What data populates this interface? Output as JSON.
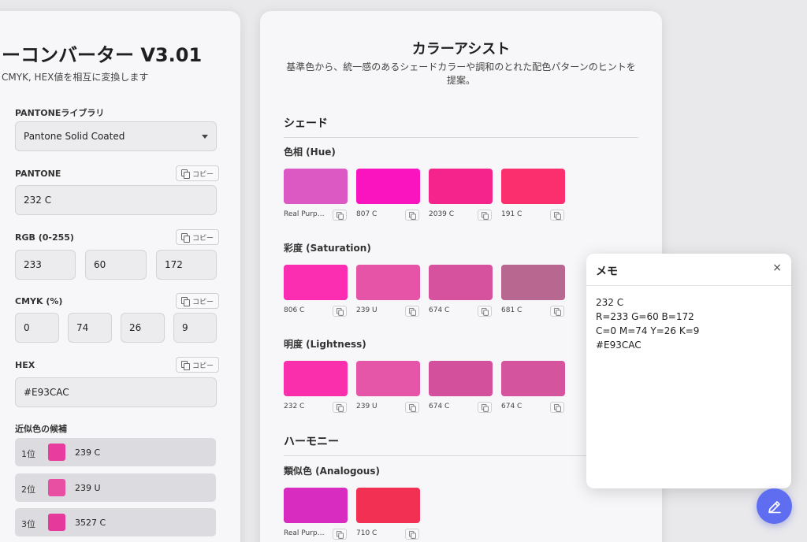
{
  "converter": {
    "title": "ーコンバーター V3.01",
    "subtitle": "CMYK, HEX値を相互に変換します",
    "library_label": "PANTONEライブラリ",
    "library_value": "Pantone Solid Coated",
    "copy_label": "コピー",
    "pantone_label": "PANTONE",
    "pantone_value": "232 C",
    "rgb_label": "RGB (0-255)",
    "rgb": [
      "233",
      "60",
      "172"
    ],
    "cmyk_label": "CMYK (%)",
    "cmyk": [
      "0",
      "74",
      "26",
      "9"
    ],
    "hex_label": "HEX",
    "hex_value": "#E93CAC",
    "candidates_label": "近似色の候補",
    "candidates": [
      {
        "rank": "1位",
        "name": "239 C",
        "color": "#e93c9f"
      },
      {
        "rank": "2位",
        "name": "239 U",
        "color": "#e84ea2"
      },
      {
        "rank": "3位",
        "name": "3527 C",
        "color": "#e5399b"
      }
    ]
  },
  "assist": {
    "title": "カラーアシスト",
    "description": "基準色から、統一感のあるシェードカラーや調和のとれた配色パターンのヒントを提案。",
    "shade_title": "シェード",
    "harmony_title": "ハーモニー",
    "groups": [
      {
        "label": "色相 (Hue)",
        "swatches": [
          {
            "name": "Real Purp…",
            "color": "#dc58c3"
          },
          {
            "name": "807 C",
            "color": "#f914c0"
          },
          {
            "name": "2039 C",
            "color": "#f4248c"
          },
          {
            "name": "191 C",
            "color": "#fb2e6e"
          }
        ]
      },
      {
        "label": "彩度 (Saturation)",
        "swatches": [
          {
            "name": "806 C",
            "color": "#fb2eb1"
          },
          {
            "name": "239 U",
            "color": "#e554a7"
          },
          {
            "name": "674 C",
            "color": "#d6529e"
          },
          {
            "name": "681 C",
            "color": "#b86791"
          }
        ]
      },
      {
        "label": "明度 (Lightness)",
        "swatches": [
          {
            "name": "232 C",
            "color": "#fa2fac"
          },
          {
            "name": "239 U",
            "color": "#e556a8"
          },
          {
            "name": "674 C",
            "color": "#d2509c"
          },
          {
            "name": "674 C",
            "color": "#d4549e"
          }
        ]
      },
      {
        "label": "類似色 (Analogous)",
        "swatches": [
          {
            "name": "Real Purp…",
            "color": "#d72cbf"
          },
          {
            "name": "710 C",
            "color": "#f23053"
          }
        ]
      }
    ]
  },
  "memo": {
    "title": "メモ",
    "close": "×",
    "text": "232 C\nR=233 G=60 B=172\nC=0 M=74 Y=26 K=9\n#E93CAC"
  },
  "icons": {
    "fab": "pencil-icon",
    "copy": "copy-icon",
    "close": "close-icon",
    "dropdown": "chevron-down-icon"
  }
}
